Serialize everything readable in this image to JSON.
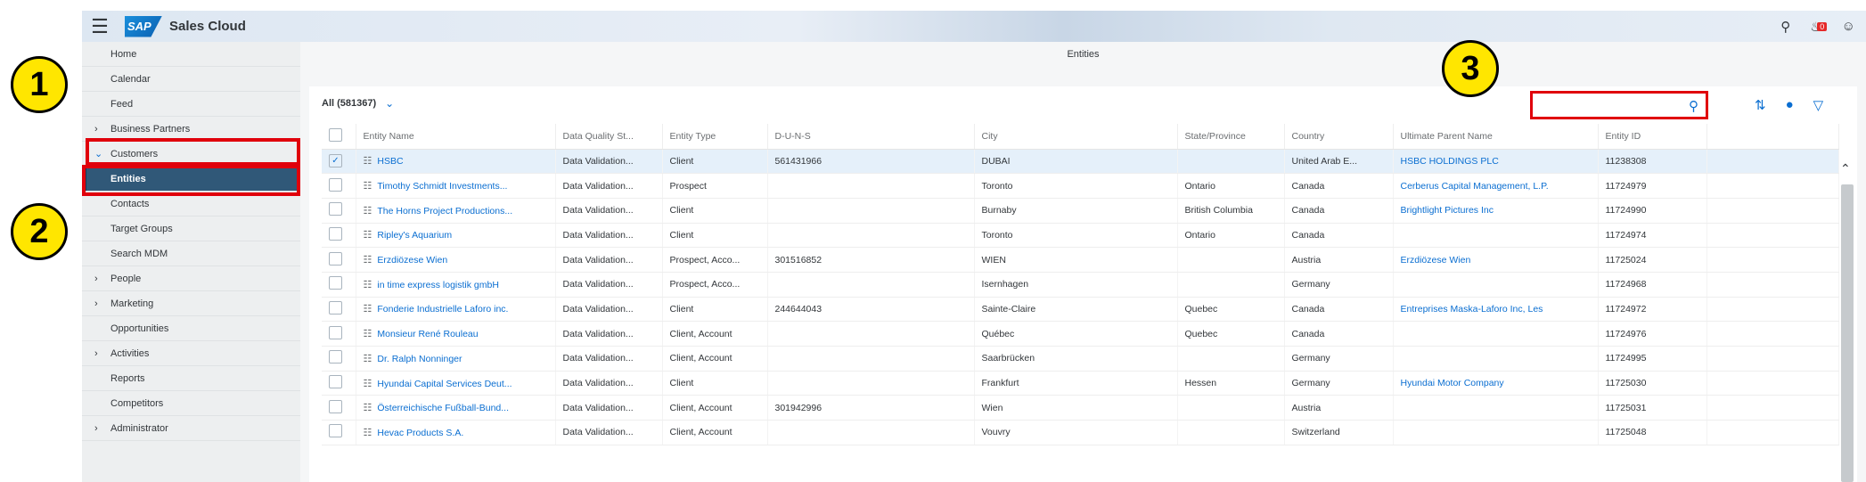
{
  "shell": {
    "logo": "SAP",
    "app_title": "Sales Cloud",
    "notification_count": "0"
  },
  "sidebar": {
    "items": [
      {
        "label": "Home"
      },
      {
        "label": "Calendar"
      },
      {
        "label": "Feed"
      },
      {
        "label": "Business Partners"
      },
      {
        "label": "Customers"
      },
      {
        "label": "Entities"
      },
      {
        "label": "Contacts"
      },
      {
        "label": "Target Groups"
      },
      {
        "label": "Search MDM"
      },
      {
        "label": "People"
      },
      {
        "label": "Marketing"
      },
      {
        "label": "Opportunities"
      },
      {
        "label": "Activities"
      },
      {
        "label": "Reports"
      },
      {
        "label": "Competitors"
      },
      {
        "label": "Administrator"
      }
    ]
  },
  "page": {
    "title": "Entities",
    "view_label": "All",
    "view_count": "(581367)"
  },
  "search": {
    "value": "",
    "placeholder": ""
  },
  "table": {
    "columns": [
      "Entity Name",
      "Data Quality St...",
      "Entity Type",
      "D-U-N-S",
      "City",
      "State/Province",
      "Country",
      "Ultimate Parent Name",
      "Entity ID"
    ],
    "rows": [
      {
        "selected": true,
        "name": "HSBC",
        "dq": "Data Validation...",
        "type": "Client",
        "duns": "561431966",
        "city": "DUBAI",
        "state": "",
        "country": "United Arab E...",
        "parent": "HSBC HOLDINGS PLC",
        "id": "11238308"
      },
      {
        "selected": false,
        "name": "Timothy Schmidt Investments...",
        "dq": "Data Validation...",
        "type": "Prospect",
        "duns": "",
        "city": "Toronto",
        "state": "Ontario",
        "country": "Canada",
        "parent": "Cerberus Capital Management, L.P.",
        "id": "11724979"
      },
      {
        "selected": false,
        "name": "The Horns Project Productions...",
        "dq": "Data Validation...",
        "type": "Client",
        "duns": "",
        "city": "Burnaby",
        "state": "British Columbia",
        "country": "Canada",
        "parent": "Brightlight Pictures Inc",
        "id": "11724990"
      },
      {
        "selected": false,
        "name": "Ripley's Aquarium",
        "dq": "Data Validation...",
        "type": "Client",
        "duns": "",
        "city": "Toronto",
        "state": "Ontario",
        "country": "Canada",
        "parent": "",
        "id": "11724974"
      },
      {
        "selected": false,
        "name": "Erzdiözese Wien",
        "dq": "Data Validation...",
        "type": "Prospect, Acco...",
        "duns": "301516852",
        "city": "WIEN",
        "state": "",
        "country": "Austria",
        "parent": "Erzdiözese Wien",
        "id": "11725024"
      },
      {
        "selected": false,
        "name": "in time express logistik gmbH",
        "dq": "Data Validation...",
        "type": "Prospect, Acco...",
        "duns": "",
        "city": "Isernhagen",
        "state": "",
        "country": "Germany",
        "parent": "",
        "id": "11724968"
      },
      {
        "selected": false,
        "name": "Fonderie Industrielle Laforo inc.",
        "dq": "Data Validation...",
        "type": "Client",
        "duns": "244644043",
        "city": "Sainte-Claire",
        "state": "Quebec",
        "country": "Canada",
        "parent": "Entreprises Maska-Laforo Inc, Les",
        "id": "11724972"
      },
      {
        "selected": false,
        "name": "Monsieur René Rouleau",
        "dq": "Data Validation...",
        "type": "Client, Account",
        "duns": "",
        "city": "Québec",
        "state": "Quebec",
        "country": "Canada",
        "parent": "",
        "id": "11724976"
      },
      {
        "selected": false,
        "name": "Dr. Ralph Nonninger",
        "dq": "Data Validation...",
        "type": "Client, Account",
        "duns": "",
        "city": "Saarbrücken",
        "state": "",
        "country": "Germany",
        "parent": "",
        "id": "11724995"
      },
      {
        "selected": false,
        "name": "Hyundai Capital Services Deut...",
        "dq": "Data Validation...",
        "type": "Client",
        "duns": "",
        "city": "Frankfurt",
        "state": "Hessen",
        "country": "Germany",
        "parent": "Hyundai Motor Company",
        "id": "11725030"
      },
      {
        "selected": false,
        "name": "Österreichische Fußball-Bund...",
        "dq": "Data Validation...",
        "type": "Client, Account",
        "duns": "301942996",
        "city": "Wien",
        "state": "",
        "country": "Austria",
        "parent": "",
        "id": "11725031"
      },
      {
        "selected": false,
        "name": "Hevac Products S.A.",
        "dq": "Data Validation...",
        "type": "Client, Account",
        "duns": "",
        "city": "Vouvry",
        "state": "",
        "country": "Switzerland",
        "parent": "",
        "id": "11725048"
      }
    ]
  },
  "annotations": {
    "callout_1": "1",
    "callout_2": "2",
    "callout_3": "3"
  },
  "colors": {
    "selected_nav": "#305878",
    "link": "#0a6ed1",
    "highlight_box": "#e0000b",
    "callout_fill": "#ffe600"
  }
}
